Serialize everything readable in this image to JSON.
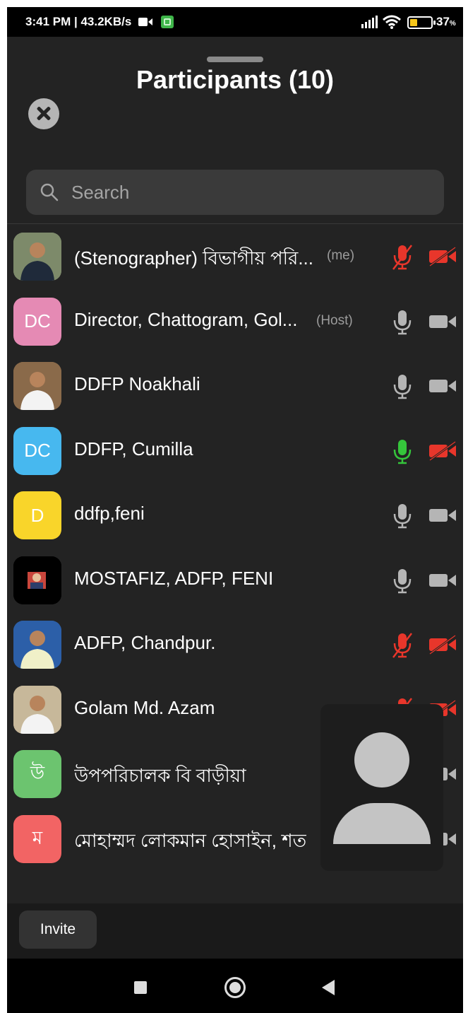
{
  "status_bar": {
    "time_info": "3:41 PM | 43.2KB/s",
    "battery_percent": "37",
    "battery_percent_suffix": "%",
    "battery_level": 0.37
  },
  "header": {
    "title": "Participants (10)"
  },
  "search": {
    "placeholder": "Search"
  },
  "participants": [
    {
      "name": "(Stenographer) বিভাগীয় পরি...",
      "tag": "(me)",
      "avatar_text": "",
      "avatar_color": "#7d8a6a",
      "mic": "muted",
      "video": "off"
    },
    {
      "name": "Director, Chattogram, Gol...",
      "tag": "(Host)",
      "avatar_text": "DC",
      "avatar_color": "#e58ab4",
      "mic": "on",
      "video": "on"
    },
    {
      "name": "DDFP Noakhali",
      "tag": "",
      "avatar_text": "",
      "avatar_color": "#8a6a4a",
      "mic": "on",
      "video": "on"
    },
    {
      "name": "DDFP, Cumilla",
      "tag": "",
      "avatar_text": "DC",
      "avatar_color": "#47b8ef",
      "mic": "speaking",
      "video": "off"
    },
    {
      "name": "ddfp,feni",
      "tag": "",
      "avatar_text": "D",
      "avatar_color": "#f9d52a",
      "mic": "on",
      "video": "on"
    },
    {
      "name": "MOSTAFIZ, ADFP, FENI",
      "tag": "",
      "avatar_text": "",
      "avatar_color": "#000000",
      "mic": "on",
      "video": "on"
    },
    {
      "name": "ADFP, Chandpur.",
      "tag": "",
      "avatar_text": "",
      "avatar_color": "#2c5fa8",
      "mic": "muted",
      "video": "off"
    },
    {
      "name": "Golam Md. Azam",
      "tag": "",
      "avatar_text": "",
      "avatar_color": "#c7b89a",
      "mic": "muted",
      "video": "off"
    },
    {
      "name": "উপপরিচালক বি বাড়ীয়া",
      "tag": "",
      "avatar_text": "উ",
      "avatar_color": "#6cc46f",
      "mic": "on",
      "video": "on"
    },
    {
      "name": "মোহাম্মদ লোকমান হোসাইন, শত",
      "tag": "",
      "avatar_text": "ম",
      "avatar_color": "#f26464",
      "mic": "on",
      "video": "on"
    }
  ],
  "colors": {
    "muted": "#e8362b",
    "speaking": "#35c53b",
    "normal": "#b5b5b5"
  },
  "footer": {
    "invite_label": "Invite"
  }
}
